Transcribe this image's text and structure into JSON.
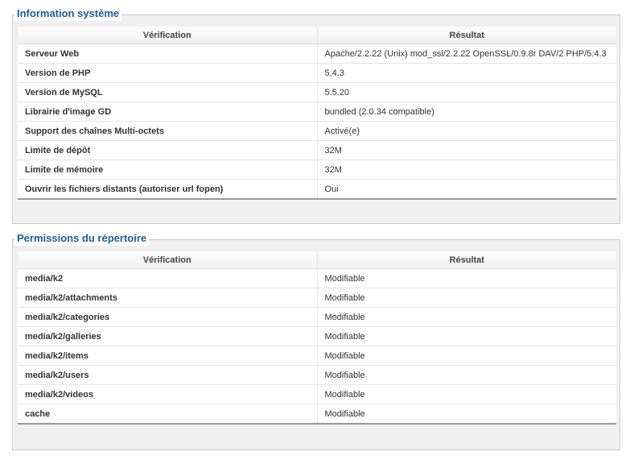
{
  "system_info": {
    "legend": "Information système",
    "headers": {
      "check": "Vérification",
      "result": "Résultat"
    },
    "rows": [
      {
        "label": "Serveur Web",
        "value": "Apache/2.2.22 (Unix) mod_ssl/2.2.22 OpenSSL/0.9.8r DAV/2 PHP/5.4.3"
      },
      {
        "label": "Version de PHP",
        "value": "5.4.3"
      },
      {
        "label": "Version de MySQL",
        "value": "5.5.20"
      },
      {
        "label": "Librairie d'image GD",
        "value": "bundled (2.0.34 compatible)"
      },
      {
        "label": "Support des chaînes Multi-octets",
        "value": "Activé(e)"
      },
      {
        "label": "Limite de dépôt",
        "value": "32M"
      },
      {
        "label": "Limite de mémoire",
        "value": "32M"
      },
      {
        "label": "Ouvrir les fichiers distants (autoriser url fopen)",
        "value": "Oui"
      }
    ]
  },
  "directory_permissions": {
    "legend": "Permissions du répertoire",
    "headers": {
      "check": "Vérification",
      "result": "Résultat"
    },
    "rows": [
      {
        "label": "media/k2",
        "value": "Modifiable"
      },
      {
        "label": "media/k2/attachments",
        "value": "Modifiable"
      },
      {
        "label": "media/k2/categories",
        "value": "Modifiable"
      },
      {
        "label": "media/k2/galleries",
        "value": "Modifiable"
      },
      {
        "label": "media/k2/items",
        "value": "Modifiable"
      },
      {
        "label": "media/k2/users",
        "value": "Modifiable"
      },
      {
        "label": "media/k2/videos",
        "value": "Modifiable"
      },
      {
        "label": "cache",
        "value": "Modifiable"
      }
    ]
  }
}
